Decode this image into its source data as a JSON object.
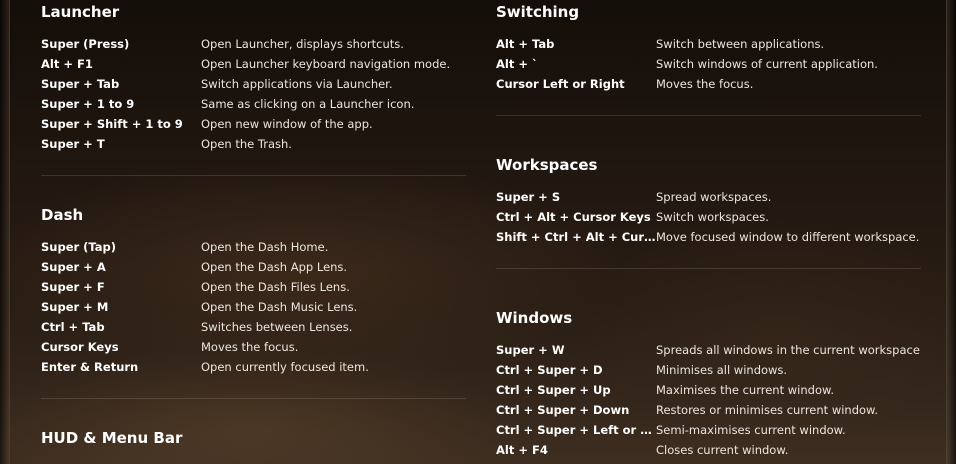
{
  "sections": {
    "launcher": {
      "title": "Launcher",
      "rows": [
        {
          "key": "Super (Press)",
          "desc": "Open Launcher, displays shortcuts."
        },
        {
          "key": "Alt + F1",
          "desc": "Open Launcher keyboard navigation mode."
        },
        {
          "key": "Super + Tab",
          "desc": "Switch applications via Launcher."
        },
        {
          "key": "Super + 1 to 9",
          "desc": "Same as clicking on a Launcher icon."
        },
        {
          "key": "Super + Shift + 1 to 9",
          "desc": "Open new window of the app."
        },
        {
          "key": "Super + T",
          "desc": "Open the Trash."
        }
      ]
    },
    "dash": {
      "title": "Dash",
      "rows": [
        {
          "key": "Super (Tap)",
          "desc": "Open the Dash Home."
        },
        {
          "key": "Super + A",
          "desc": "Open the Dash App Lens."
        },
        {
          "key": "Super + F",
          "desc": "Open the Dash Files Lens."
        },
        {
          "key": "Super + M",
          "desc": "Open the Dash Music Lens."
        },
        {
          "key": "Ctrl + Tab",
          "desc": "Switches between Lenses."
        },
        {
          "key": "Cursor Keys",
          "desc": "Moves the focus."
        },
        {
          "key": "Enter & Return",
          "desc": "Open currently focused item."
        }
      ]
    },
    "hud": {
      "title": "HUD & Menu Bar"
    },
    "switching": {
      "title": "Switching",
      "rows": [
        {
          "key": "Alt + Tab",
          "desc": "Switch between applications."
        },
        {
          "key": "Alt + `",
          "desc": "Switch windows of current application."
        },
        {
          "key": "Cursor Left or Right",
          "desc": "Moves the focus."
        }
      ]
    },
    "workspaces": {
      "title": "Workspaces",
      "rows": [
        {
          "key": "Super + S",
          "desc": "Spread workspaces."
        },
        {
          "key": "Ctrl + Alt + Cursor Keys",
          "desc": "Switch workspaces."
        },
        {
          "key": "Shift + Ctrl + Alt + Curs…",
          "desc": "Move focused window to different workspace."
        }
      ]
    },
    "windows": {
      "title": "Windows",
      "rows": [
        {
          "key": "Super + W",
          "desc": "Spreads all windows in the current workspace."
        },
        {
          "key": "Ctrl + Super + D",
          "desc": "Minimises all windows."
        },
        {
          "key": "Ctrl + Super + Up",
          "desc": "Maximises the current window."
        },
        {
          "key": "Ctrl + Super + Down",
          "desc": "Restores or minimises current window."
        },
        {
          "key": "Ctrl + Super + Left or Ri…",
          "desc": "Semi-maximises current window."
        },
        {
          "key": "Alt + F4",
          "desc": "Closes current window."
        }
      ]
    }
  }
}
